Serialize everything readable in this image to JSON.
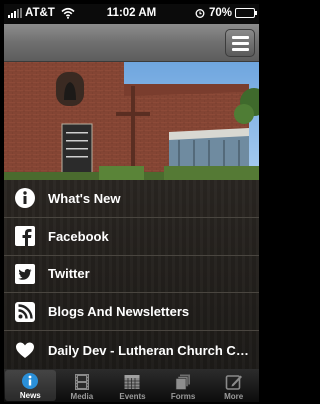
{
  "status_bar": {
    "carrier": "AT&T",
    "time": "11:02 AM",
    "battery": "70%",
    "battery_level": 0.7
  },
  "nav": {
    "menu_icon": "menu-icon"
  },
  "menu": {
    "items": [
      {
        "label": "What's New",
        "icon": "info-icon"
      },
      {
        "label": "Facebook",
        "icon": "facebook-icon"
      },
      {
        "label": "Twitter",
        "icon": "twitter-icon"
      },
      {
        "label": "Blogs And Newsletters",
        "icon": "rss-icon"
      },
      {
        "label": "Daily Dev - Lutheran Church Ch...",
        "icon": "heart-icon"
      }
    ]
  },
  "tabs": [
    {
      "label": "News",
      "icon": "info-icon",
      "active": true
    },
    {
      "label": "Media",
      "icon": "film-icon",
      "active": false
    },
    {
      "label": "Events",
      "icon": "calendar-icon",
      "active": false
    },
    {
      "label": "Forms",
      "icon": "stack-icon",
      "active": false
    },
    {
      "label": "More",
      "icon": "edit-icon",
      "active": false
    }
  ],
  "colors": {
    "tab_active_badge": "#2a8fd8",
    "list_bg": "#221f1b"
  }
}
